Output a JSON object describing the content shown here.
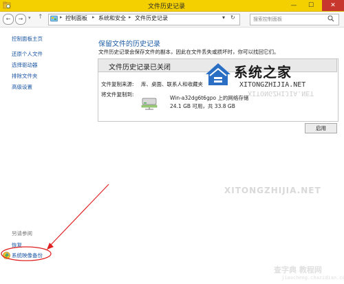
{
  "window": {
    "title": "文件历史记录",
    "minimize": "—",
    "maximize": "☐",
    "close": "✕"
  },
  "nav": {
    "back": "←",
    "forward": "→",
    "recent": "▾",
    "up": "↑",
    "breadcrumbs": [
      "控制面板",
      "系统和安全",
      "文件历史记录"
    ],
    "separator": "▸",
    "address_dropdown": "▾",
    "refresh": "↻",
    "search_placeholder": "搜索控制面板"
  },
  "sidebar": {
    "home": "控制面板主页",
    "items": [
      "还原个人文件",
      "选择驱动器",
      "排除文件夹",
      "高级设置"
    ],
    "see_also_title": "另请参阅",
    "see_also": [
      "恢复",
      "系统映像备份"
    ]
  },
  "main": {
    "heading": "保留文件的历史记录",
    "description": "文件历史记录会保存文件的副本，因此在文件丢失或损坏时，你可以找回它们。",
    "panel": {
      "title": "文件历史记录已关闭",
      "copy_from_label": "文件复制来源:",
      "copy_from_value": "库、桌面、联系人和收藏夹",
      "copy_to_label": "将文件复制到:",
      "drive_name": "Win-a32dg6t6gpo 上的网络存储",
      "drive_space": "24.1 GB 可用，共 33.8 GB"
    },
    "enable_button": "启用"
  },
  "watermarks": {
    "logo_text": "系统之家",
    "logo_url": "XITONGZHIJIA.NET",
    "logo_url_mirror": "XITONGZHIJIA.NET",
    "middle": "XITONGZHIJIA.NET",
    "bottom_cn": "查字典 教程网",
    "bottom_url": "jiaocheng.chazidian.com"
  },
  "colors": {
    "titlebar": "#f4d000",
    "link": "#1c57a5",
    "heading": "#1e5fa7",
    "close": "#c8372d",
    "annotation": "#e02020"
  }
}
